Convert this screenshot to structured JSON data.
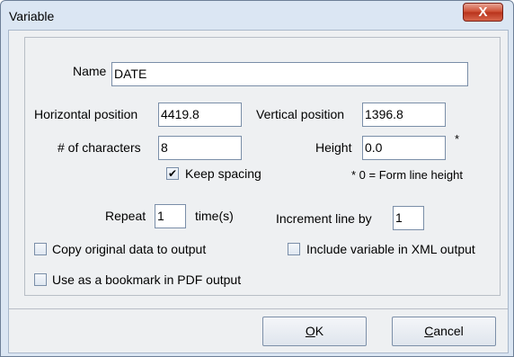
{
  "window": {
    "title": "Variable",
    "close_glyph": "X",
    "close_icon": "close-icon"
  },
  "fields": {
    "name_label": "Name",
    "name_value": "DATE",
    "hpos_label": "Horizontal position",
    "hpos_value": "4419.8",
    "vpos_label": "Vertical position",
    "vpos_value": "1396.8",
    "chars_label": "# of characters",
    "chars_value": "8",
    "height_label": "Height",
    "height_value": "0.0",
    "height_asterisk": "*",
    "keep_spacing_label": "Keep spacing",
    "keep_spacing_checked": true,
    "height_note": "* 0 = Form line height",
    "repeat_label": "Repeat",
    "repeat_value": "1",
    "times_label": "time(s)",
    "increment_label": "Increment line by",
    "increment_value": "1",
    "copy_original_label": "Copy original data to output",
    "copy_original_checked": false,
    "include_xml_label": "Include variable in XML output",
    "include_xml_checked": false,
    "bookmark_label": "Use as a bookmark in PDF output",
    "bookmark_checked": false
  },
  "buttons": {
    "ok": {
      "mnemonic": "O",
      "rest": "K"
    },
    "cancel": {
      "mnemonic": "C",
      "rest": "ancel"
    }
  },
  "check_glyph": "✔"
}
